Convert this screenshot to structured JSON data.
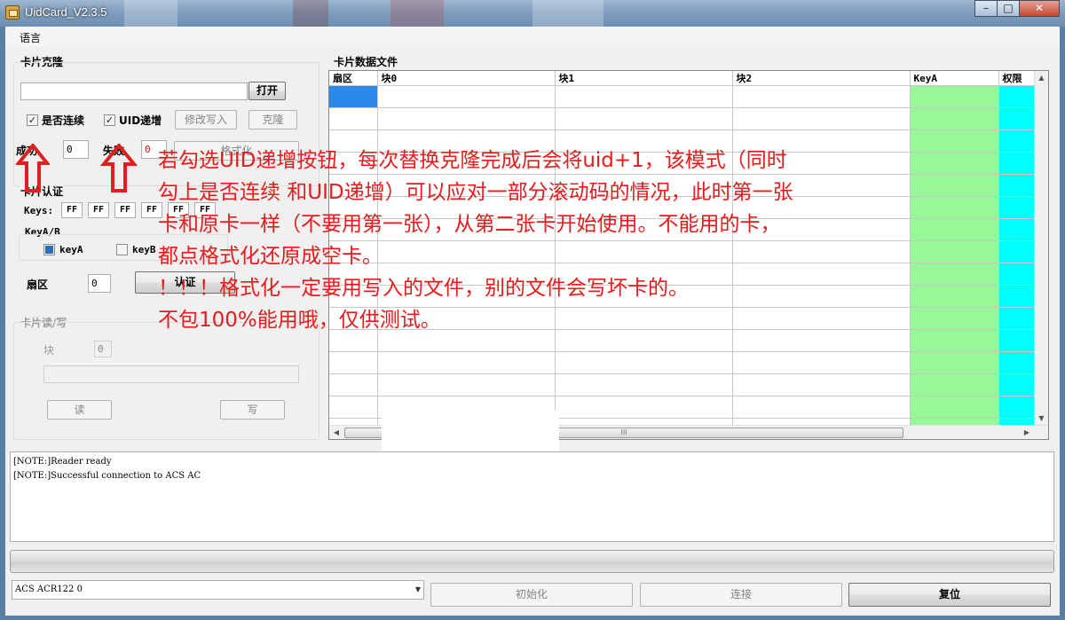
{
  "window": {
    "title": "UidCard_V2.3.5"
  },
  "menu": {
    "language": "语言"
  },
  "clone": {
    "title": "卡片克隆",
    "open_button": "打开",
    "continuous_label": "是否连续",
    "uid_increment_label": "UID递增",
    "modify_write_button": "修改写入",
    "clone_button": "克隆",
    "success_label": "成功",
    "success_value": "0",
    "fail_label": "失败",
    "fail_value": "0",
    "format_button": "格式化"
  },
  "auth": {
    "title": "卡片认证",
    "keys_label": "Keys:",
    "keys": [
      "FF",
      "FF",
      "FF",
      "FF",
      "FF",
      "FF"
    ],
    "keyab_label": "KeyA/B",
    "keya_label": "keyA",
    "keyb_label": "keyB",
    "sector_label": "扇区",
    "sector_value": "0",
    "auth_button": "认证"
  },
  "readwrite": {
    "title": "卡片读/写",
    "block_label": "块",
    "block_value": "0",
    "read_button": "读",
    "write_button": "写"
  },
  "datafile": {
    "title": "卡片数据文件",
    "columns": [
      "扇区",
      "块0",
      "块1",
      "块2",
      "KeyA",
      "权限"
    ],
    "scroll_mark": "III"
  },
  "log": {
    "lines": [
      "[NOTE:]Reader ready",
      "[NOTE:]Successful connection to ACS AC"
    ]
  },
  "bottom": {
    "reader_select": "ACS ACR122 0",
    "init_button": "初始化",
    "connect_button": "连接",
    "reset_button": "复位"
  },
  "annotation": {
    "lines": [
      "若勾选UID递增按钮，每次替换克隆完成后会将uid+1，该模式（同时",
      "勾上是否连续 和UID递增）可以应对一部分滚动码的情况，此时第一张",
      "卡和原卡一样（不要用第一张），从第二张卡开始使用。不能用的卡，",
      "都点格式化还原成空卡。",
      "！！！格式化一定要用写入的文件，别的文件会写坏卡的。",
      "不包100%能用哦，仅供测试。"
    ],
    "color": "#e81b1b"
  },
  "icons": {
    "check": "✓",
    "minimize": "–",
    "maximize": "□",
    "close": "✕",
    "scroll_up": "▲",
    "scroll_down": "▼",
    "scroll_left": "◀",
    "scroll_right": "▶",
    "dropdown": "▼"
  }
}
